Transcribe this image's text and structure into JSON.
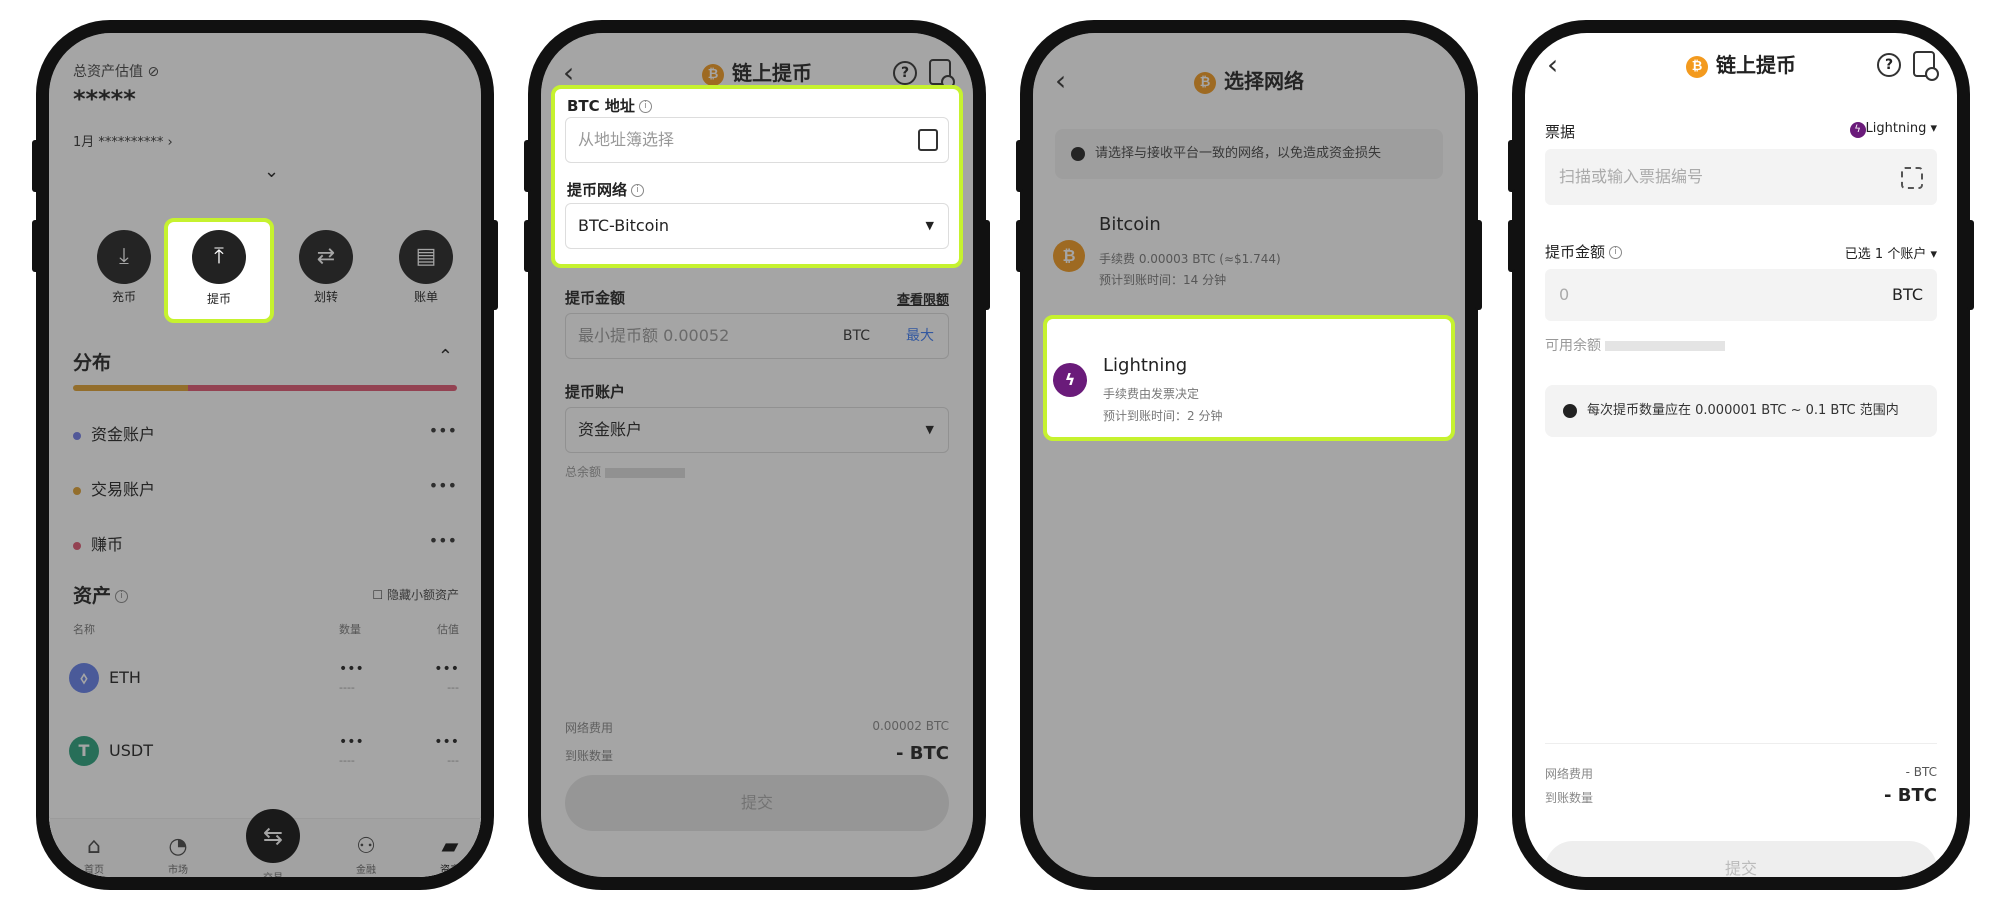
{
  "s1": {
    "total_label": "总资产估值",
    "hidden_value": "*****",
    "sub_value": "1月 ********** ›",
    "chevron": "⌄",
    "actions": [
      {
        "label": "充币",
        "icon": "download-icon"
      },
      {
        "label": "提币",
        "icon": "upload-icon"
      },
      {
        "label": "划转",
        "icon": "transfer-icon"
      },
      {
        "label": "账单",
        "icon": "bill-icon"
      }
    ],
    "dist_title": "分布",
    "accounts": [
      {
        "name": "资金账户",
        "color": "#6f7ae8",
        "val": "•••"
      },
      {
        "name": "交易账户",
        "color": "#e0a030",
        "val": "•••"
      },
      {
        "name": "赚币",
        "color": "#e05570",
        "val": "•••"
      }
    ],
    "assets_title": "资产",
    "hide_small": "隐藏小额资产",
    "col_name": "名称",
    "col_qty": "数量",
    "col_val": "估值",
    "tokens": [
      {
        "sym": "ETH",
        "icon": "⬨",
        "color": "#627eea",
        "v1": "•••",
        "v2": "----",
        "v3": "•••",
        "v4": "---"
      },
      {
        "sym": "USDT",
        "icon": "T",
        "color": "#26a17b",
        "v1": "•••",
        "v2": "----",
        "v3": "•••",
        "v4": "---"
      }
    ],
    "tabs": [
      {
        "label": "首页",
        "icon": "⌂"
      },
      {
        "label": "市场",
        "icon": "◔"
      },
      {
        "label": "交易",
        "icon": "⇆"
      },
      {
        "label": "金融",
        "icon": "⚇"
      },
      {
        "label": "资产",
        "icon": "▰"
      }
    ]
  },
  "s2": {
    "title": "链上提币",
    "addr_label": "BTC 地址",
    "addr_placeholder": "从地址簿选择",
    "net_label": "提币网络",
    "net_value": "BTC-Bitcoin",
    "amt_label": "提币金额",
    "view_limit": "查看限额",
    "amt_placeholder": "最小提币额 0.00052",
    "amt_unit": "BTC",
    "amt_max": "最大",
    "acct_label": "提币账户",
    "acct_value": "资金账户",
    "balance": "总余额 ",
    "fee_label": "网络费用",
    "fee_value": "0.00002 BTC",
    "recv_label": "到账数量",
    "recv_value": "- BTC",
    "submit": "提交"
  },
  "s3": {
    "title": "选择网络",
    "notice": "请选择与接收平台一致的网络，以免造成资金损失",
    "networks": [
      {
        "name": "Bitcoin",
        "fee": "手续费 0.00003 BTC (≈$1.744)",
        "time": "预计到账时间：14 分钟"
      },
      {
        "name": "Lightning",
        "fee": "手续费由发票决定",
        "time": "预计到账时间：2 分钟"
      }
    ]
  },
  "s4": {
    "title": "链上提币",
    "invoice_label": "票据",
    "network_tag": "Lightning",
    "invoice_placeholder": "扫描或输入票据编号",
    "amt_label": "提币金额",
    "account_select": "已选 1 个账户",
    "amt_value": "0",
    "amt_unit": "BTC",
    "avail": "可用余额",
    "notice": "每次提币数量应在 0.000001 BTC ~ 0.1 BTC 范围内",
    "fee_label": "网络费用",
    "fee_value": "- BTC",
    "recv_label": "到账数量",
    "recv_value": "- BTC",
    "submit": "提交"
  }
}
